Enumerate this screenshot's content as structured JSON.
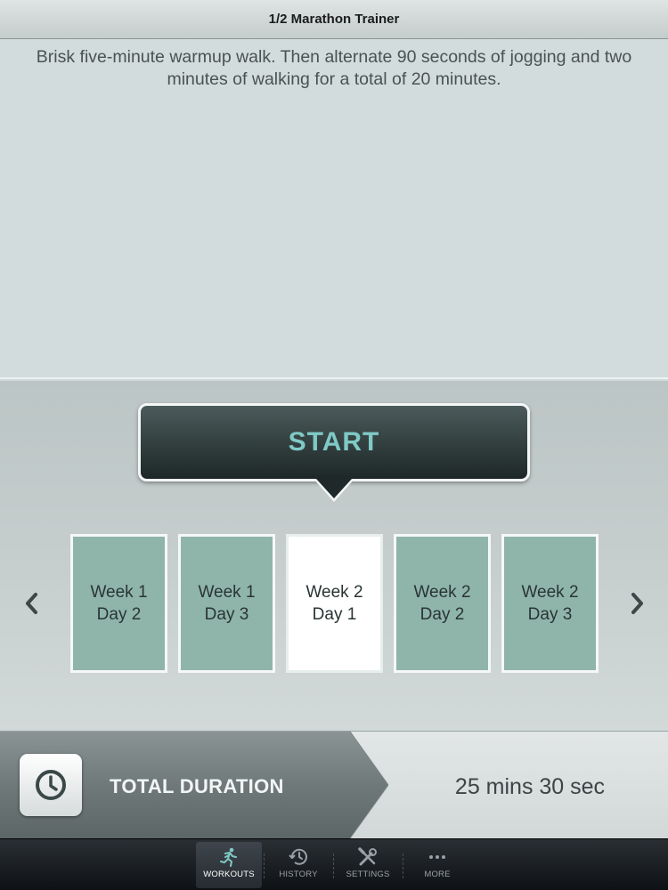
{
  "app": {
    "title": "1/2 Marathon Trainer"
  },
  "workout": {
    "description": "Brisk five-minute warmup walk. Then alternate 90 seconds of jogging and two minutes of walking for a total of 20 minutes.",
    "start_label": "START"
  },
  "days": [
    {
      "week": "Week 1",
      "day": "Day 2",
      "selected": false
    },
    {
      "week": "Week 1",
      "day": "Day 3",
      "selected": false
    },
    {
      "week": "Week 2",
      "day": "Day 1",
      "selected": true
    },
    {
      "week": "Week 2",
      "day": "Day 2",
      "selected": false
    },
    {
      "week": "Week 2",
      "day": "Day 3",
      "selected": false
    }
  ],
  "duration": {
    "label": "TOTAL DURATION",
    "value": "25 mins 30 sec",
    "icon": "clock-icon"
  },
  "tabs": [
    {
      "label": "WORKOUTS",
      "icon": "runner-icon",
      "active": true
    },
    {
      "label": "HISTORY",
      "icon": "history-icon",
      "active": false
    },
    {
      "label": "SETTINGS",
      "icon": "tools-icon",
      "active": false
    },
    {
      "label": "MORE",
      "icon": "more-icon",
      "active": false
    }
  ],
  "colors": {
    "accent": "#7fc9c6",
    "tile": "#8fb5ab",
    "tile_selected": "#ffffff"
  }
}
